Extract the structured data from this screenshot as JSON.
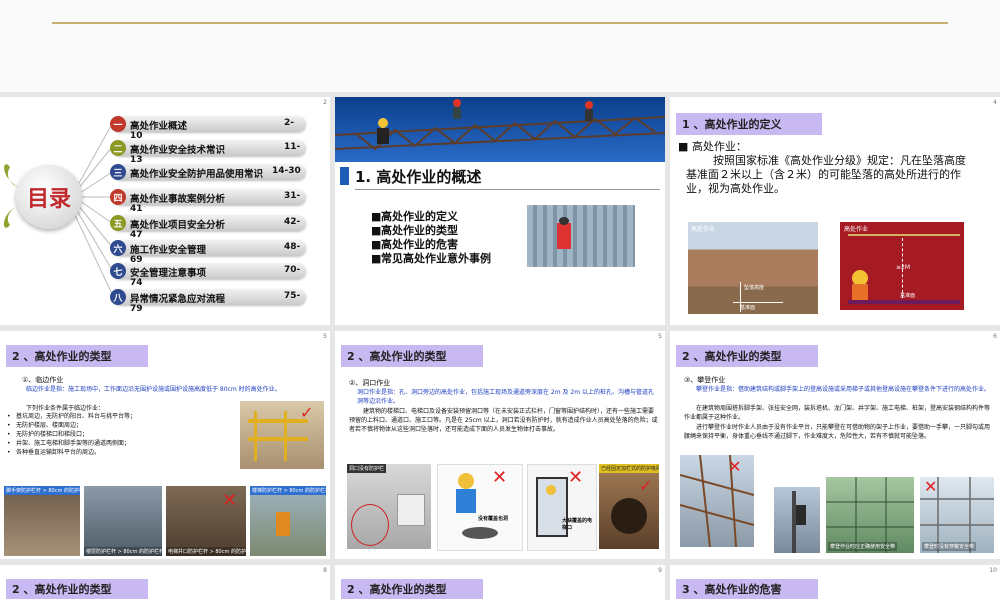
{
  "slide1": {
    "num": "2",
    "logo": "目录",
    "items": [
      {
        "badge": "一",
        "label": "高处作业概述",
        "pages": "2-",
        "pages2": "10",
        "color": "#c0392b"
      },
      {
        "badge": "二",
        "label": "高处作业安全技术常识",
        "pages": "11-",
        "pages2": "13",
        "color": "#8c9a25"
      },
      {
        "badge": "三",
        "label": "高处作业安全防护用品使用常识",
        "pages": "14-30",
        "pages2": "",
        "color": "#2f4a8f"
      },
      {
        "badge": "四",
        "label": "高处作业事故案例分析",
        "pages": "31-",
        "pages2": "41",
        "color": "#c0392b"
      },
      {
        "badge": "五",
        "label": "高处作业项目安全分析",
        "pages": "42-",
        "pages2": "47",
        "color": "#8c9a25"
      },
      {
        "badge": "六",
        "label": "施工作业安全管理",
        "pages": "48-",
        "pages2": "69",
        "color": "#2f4a8f"
      },
      {
        "badge": "七",
        "label": "安全管理注意事项",
        "pages": "70-",
        "pages2": "74",
        "color": "#2f4a8f"
      },
      {
        "badge": "八",
        "label": "异常情况紧急应对流程",
        "pages": "75-",
        "pages2": "79",
        "color": "#2f4a8f"
      }
    ]
  },
  "slide2": {
    "title": "1. 高处作业的概述",
    "bullets": [
      "高处作业的定义",
      "高处作业的类型",
      "高处作业的危害",
      "常见高处作业意外事例"
    ]
  },
  "slide3": {
    "num": "4",
    "band": "1 、高处作业的定义",
    "lead": "高处作业：",
    "body": "按照国家标准《高处作业分级》规定：凡在坠落高度基准面２米以上（含２米）的可能坠落的高处所进行的作业，视为高处作业。",
    "photo1_label": "高处作业",
    "photo1_base": "基准面",
    "photo1_height": "坠落高度",
    "photo2_label": "高处作业",
    "photo2_ge2m": "≥2M",
    "photo2_base": "基准面"
  },
  "slide4": {
    "num": "5",
    "band": "2 、高处作业的类型",
    "sub": "①、临边作业",
    "def": "临边作业是指：施工现场中，工作面边沿无围护设施或围护设施高度低于 80cm 时的高处作业。",
    "intro": "下列作业条件属于临边作业：",
    "items": [
      "基坑周边，无防护的阳台、料台与挑平台等；",
      "无防护楼层、楼面周边；",
      "无防护的楼梯口和梯段口；",
      "井架、施工电梯和脚手架等的通道两侧面；",
      "各种垂直运输卸料平台的周边。"
    ],
    "captions": [
      "脚手架防护栏杆 > 80cm 的防护栏杆",
      "楼层防护栏杆 > 80cm 的防护栏杆",
      "电梯井口防护栏杆 > 80cm 的防护栏杆",
      "楼梯防护栏杆 > 80cm 的防护栏杆"
    ]
  },
  "slide5": {
    "num": "5",
    "band": "2 、高处作业的类型",
    "sub": "②、洞口作业",
    "def": "洞口作业是指：孔、洞口旁边的高处作业，包括施工现场及通道旁深度在 2m 及 2m 以上的桩孔、沟槽与管道孔洞等边沿作业。",
    "body": "建筑物的楼梯口、电梯口及设备安装预留洞口等（在未安装正式栏杆，门窗等围护结构时），还有一些施工需要预留的上料口、通道口、施工口等。凡是在 25cm 以上，洞口若没有防护时，就有造成作业人员高处坠落的危险；或者若不慎将物体从这些洞口坠落时，还可能造成下面的人员发生物体打击事故。",
    "img1": "洞口没有防护栏",
    "img2": "没有覆盖也洞",
    "img3": "大缺覆盖的电梯口",
    "img4": "已经固定加栏式的防护吸网"
  },
  "slide6": {
    "num": "6",
    "band": "2 、高处作业的类型",
    "sub": "③、攀登作业",
    "def": "攀登作业是指：借助建筑结构或脚手架上的登高设施或采用梯子或其他登高设施在攀登条件下进行的高处作业。",
    "body1": "在建筑物周围搭拆脚手架、张挂安全网，装拆塔机、龙门架、井字架、施工电梯、桩架，登高安装钢结构构件等作业都属于这种作业。",
    "body2": "进行攀登作业时作业人员由于没有作业平台，只能攀登在可借助物的架子上作业，要借助一手攀，一只脚勾或用腰绳来保持平衡，身体重心垂线不通过脚下，作业难度大，危险性大，若有不慎就可能坠落。",
    "cap1": "攀登作业时应正确使用安全带",
    "cap2": "攀登时没有穿戴安全带"
  },
  "row3": [
    {
      "num": "8",
      "band": "2 、高处作业的类型"
    },
    {
      "num": "9",
      "band": "2 、高处作业的类型"
    },
    {
      "num": "10",
      "band": "3 、高处作业的危害"
    }
  ]
}
